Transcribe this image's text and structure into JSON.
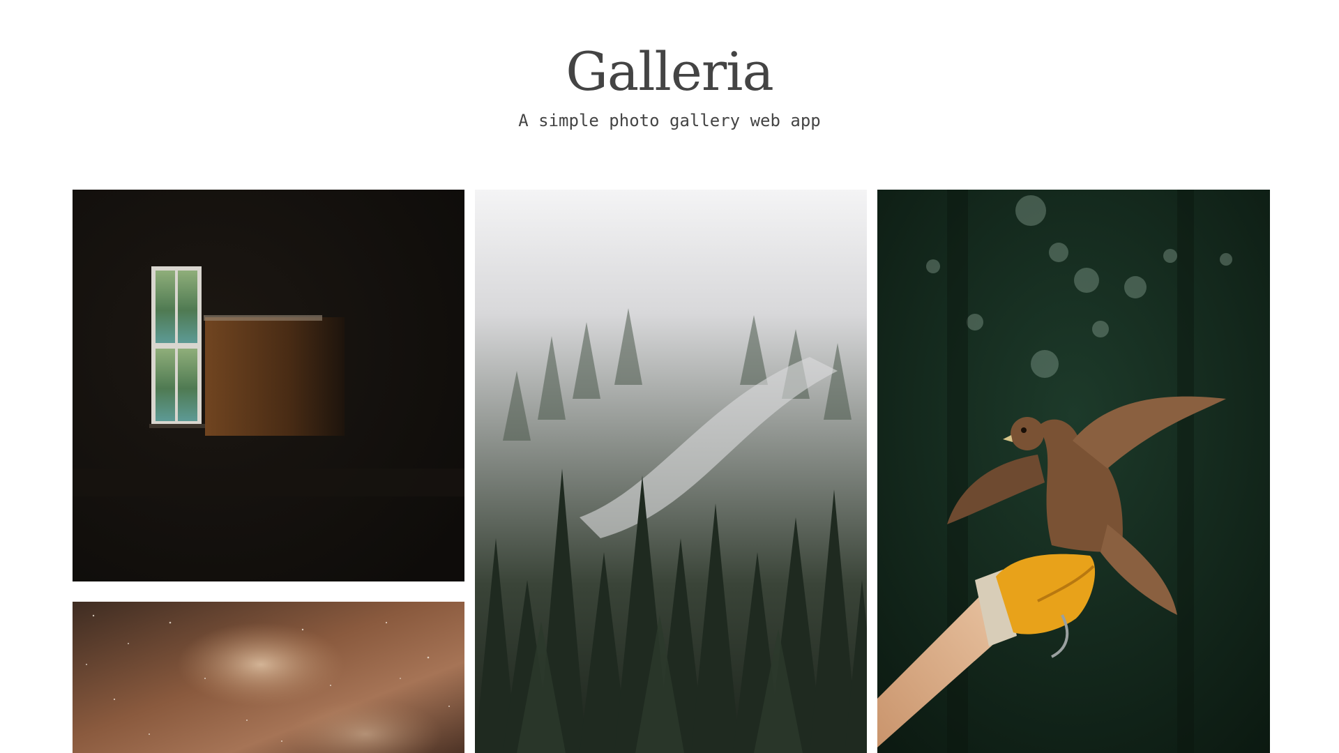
{
  "header": {
    "title": "Galleria",
    "subtitle": "A simple photo gallery web app"
  },
  "gallery": {
    "items": [
      {
        "subject": "dark room with window",
        "palette": [
          "#120f0c",
          "#6b3e1c",
          "#3f6a60"
        ]
      },
      {
        "subject": "starry night sky",
        "palette": [
          "#4a3325",
          "#8a5a3e",
          "#d8b89a"
        ]
      },
      {
        "subject": "misty pine forest",
        "palette": [
          "#f2f2f3",
          "#8c918c",
          "#1e2820"
        ]
      },
      {
        "subject": "kestrel on gloved hand",
        "palette": [
          "#0f2016",
          "#e8a21a",
          "#7a5234"
        ]
      }
    ]
  },
  "colors": {
    "background": "#ffffff",
    "text": "#444444"
  }
}
